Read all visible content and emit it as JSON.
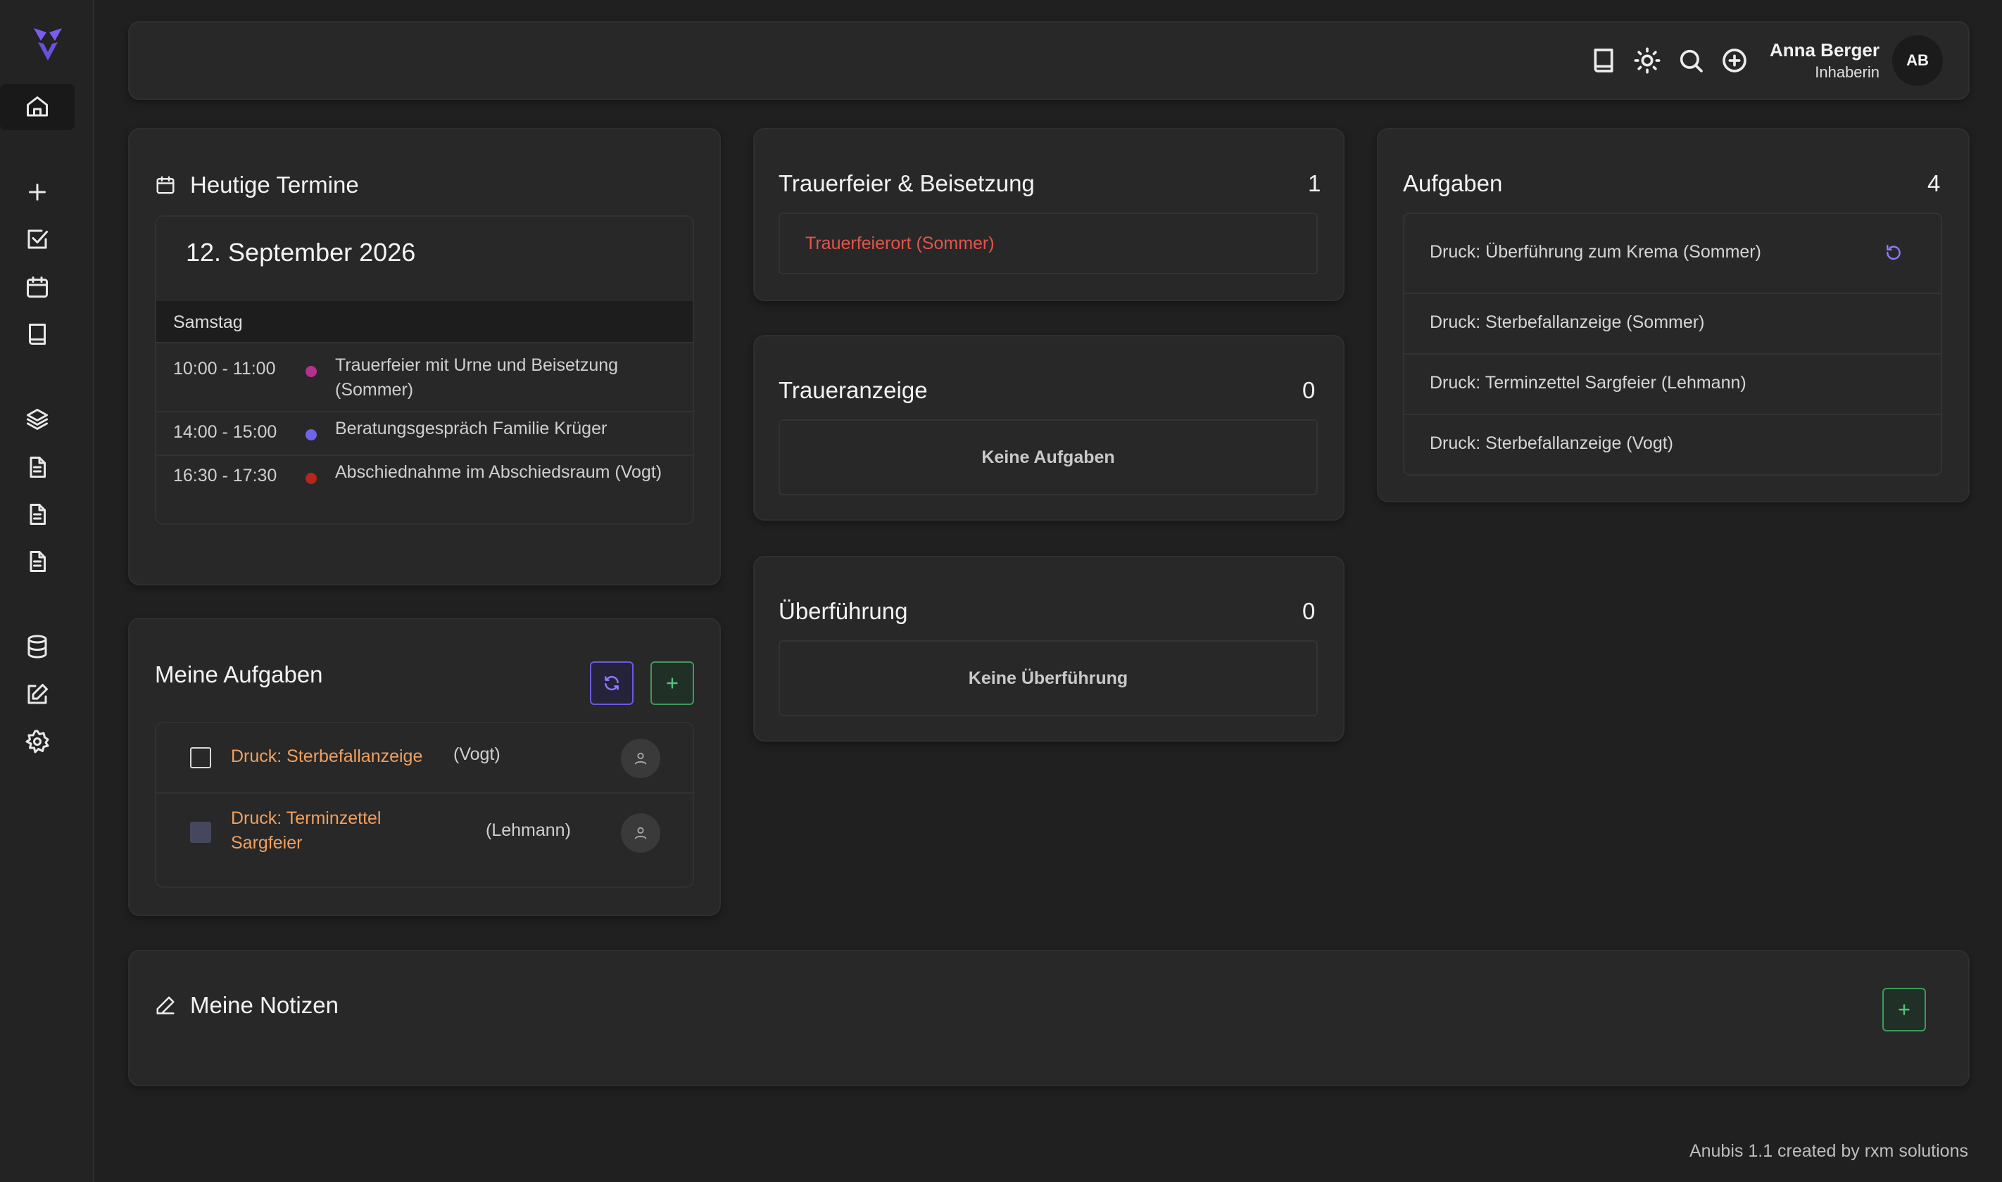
{
  "user": {
    "name": "Anna Berger",
    "role": "Inhaberin",
    "initials": "AB"
  },
  "sidebar": {
    "items": [
      {
        "icon": "home-icon",
        "active": true
      },
      {
        "icon": "plus-icon"
      },
      {
        "icon": "checkbox-icon"
      },
      {
        "icon": "calendar-icon"
      },
      {
        "icon": "book-icon"
      },
      {
        "icon": "layers-icon"
      },
      {
        "icon": "document-icon"
      },
      {
        "icon": "document-icon"
      },
      {
        "icon": "document-icon"
      },
      {
        "icon": "database-icon"
      },
      {
        "icon": "edit-icon"
      },
      {
        "icon": "settings-icon"
      }
    ]
  },
  "topbar": {
    "icons": [
      "book-icon",
      "sun-icon",
      "search-icon",
      "plus-circle-icon"
    ]
  },
  "termine": {
    "title": "Heutige Termine",
    "date": "12. September 2026",
    "day": "Samstag",
    "appointments": [
      {
        "time": "10:00 - 11:00",
        "title": "Trauerfeier mit Urne und Beisetzung (Sommer)",
        "color": "#b2328e"
      },
      {
        "time": "14:00 - 15:00",
        "title": "Beratungsgespräch Familie Krüger",
        "color": "#6f63e8"
      },
      {
        "time": "16:30 - 17:30",
        "title": "Abschiednahme im Abschiedsraum (Vogt)",
        "color": "#b5261f"
      }
    ]
  },
  "meine_aufgaben": {
    "title": "Meine Aufgaben",
    "tasks": [
      {
        "title": "Druck: Sterbefallanzeige",
        "owner": "(Vogt)",
        "checked": false
      },
      {
        "title": "Druck: Terminzettel Sargfeier",
        "owner": "(Lehmann)",
        "checked": true
      }
    ]
  },
  "trauerfeier": {
    "title": "Trauerfeier & Beisetzung",
    "count": "1",
    "items": [
      "Trauerfeierort (Sommer)"
    ]
  },
  "traueranzeige": {
    "title": "Traueranzeige",
    "count": "0",
    "empty": "Keine Aufgaben"
  },
  "ueberfuehrung": {
    "title": "Überführung",
    "count": "0",
    "empty": "Keine Überführung"
  },
  "aufgaben": {
    "title": "Aufgaben",
    "count": "4",
    "items": [
      "Druck: Überführung zum Krema (Sommer)",
      "Druck: Sterbefallanzeige (Sommer)",
      "Druck: Terminzettel Sargfeier (Lehmann)",
      "Druck: Sterbefallanzeige (Vogt)"
    ]
  },
  "notizen": {
    "title": "Meine Notizen"
  },
  "footer": {
    "text": "Anubis 1.1 created by rxm solutions"
  },
  "colors": {
    "accent_purple": "#6a5ae0",
    "accent_green": "#3f9a5a",
    "alert_red": "#e5534b",
    "task_orange": "#f0a060"
  }
}
